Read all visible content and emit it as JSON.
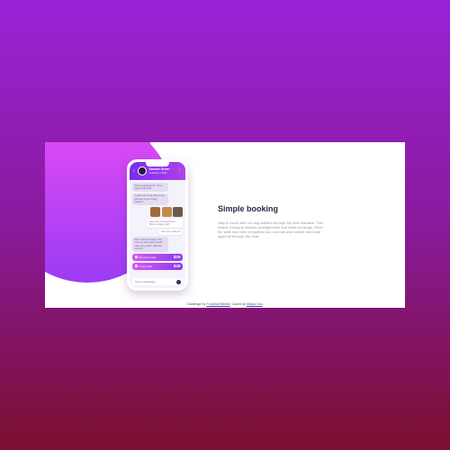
{
  "chat": {
    "header": {
      "name": "Samuel Green",
      "status": "Available to Walk"
    },
    "messages": [
      {
        "side": "left",
        "text": "That sounds great. I'd be happy with that."
      },
      {
        "side": "left",
        "text": "Could you send over some pictures of your dog, please?"
      },
      {
        "side": "right",
        "text": "Here are a few pictures. She's a happy girl!"
      },
      {
        "side": "right",
        "text": "Can you make it?"
      },
      {
        "side": "left",
        "text": "She looks so happy! The time we discussed works. How long shall I take her out for?"
      }
    ],
    "photo_colors": [
      "#a06a3a",
      "#c48a4a",
      "#6a5a4a"
    ],
    "plans": [
      {
        "name": "30 minute walk",
        "price": "$29"
      },
      {
        "name": "1 hour walk",
        "price": "$49"
      }
    ],
    "input_placeholder": "Type a message..."
  },
  "main": {
    "title": "Simple booking",
    "description": "Stay in touch with our dog walkers through the chat interface. This makes it easy to discuss arrangements and make bookings. Once the walk has been completed you can rate your walker and book again all through the chat."
  },
  "footer": {
    "prefix": "Challenge by",
    "challenge_link": "Frontend Mentor",
    "separator": ". Coded by",
    "author_link": "Mayra Ozo",
    "suffix": "."
  },
  "colors": {
    "accent_gradient_start": "#e44cf6",
    "accent_gradient_end": "#8b3bf0",
    "title_color": "#2f2a45",
    "background_top": "#9b22d6",
    "background_bottom": "#7a0f2e"
  }
}
